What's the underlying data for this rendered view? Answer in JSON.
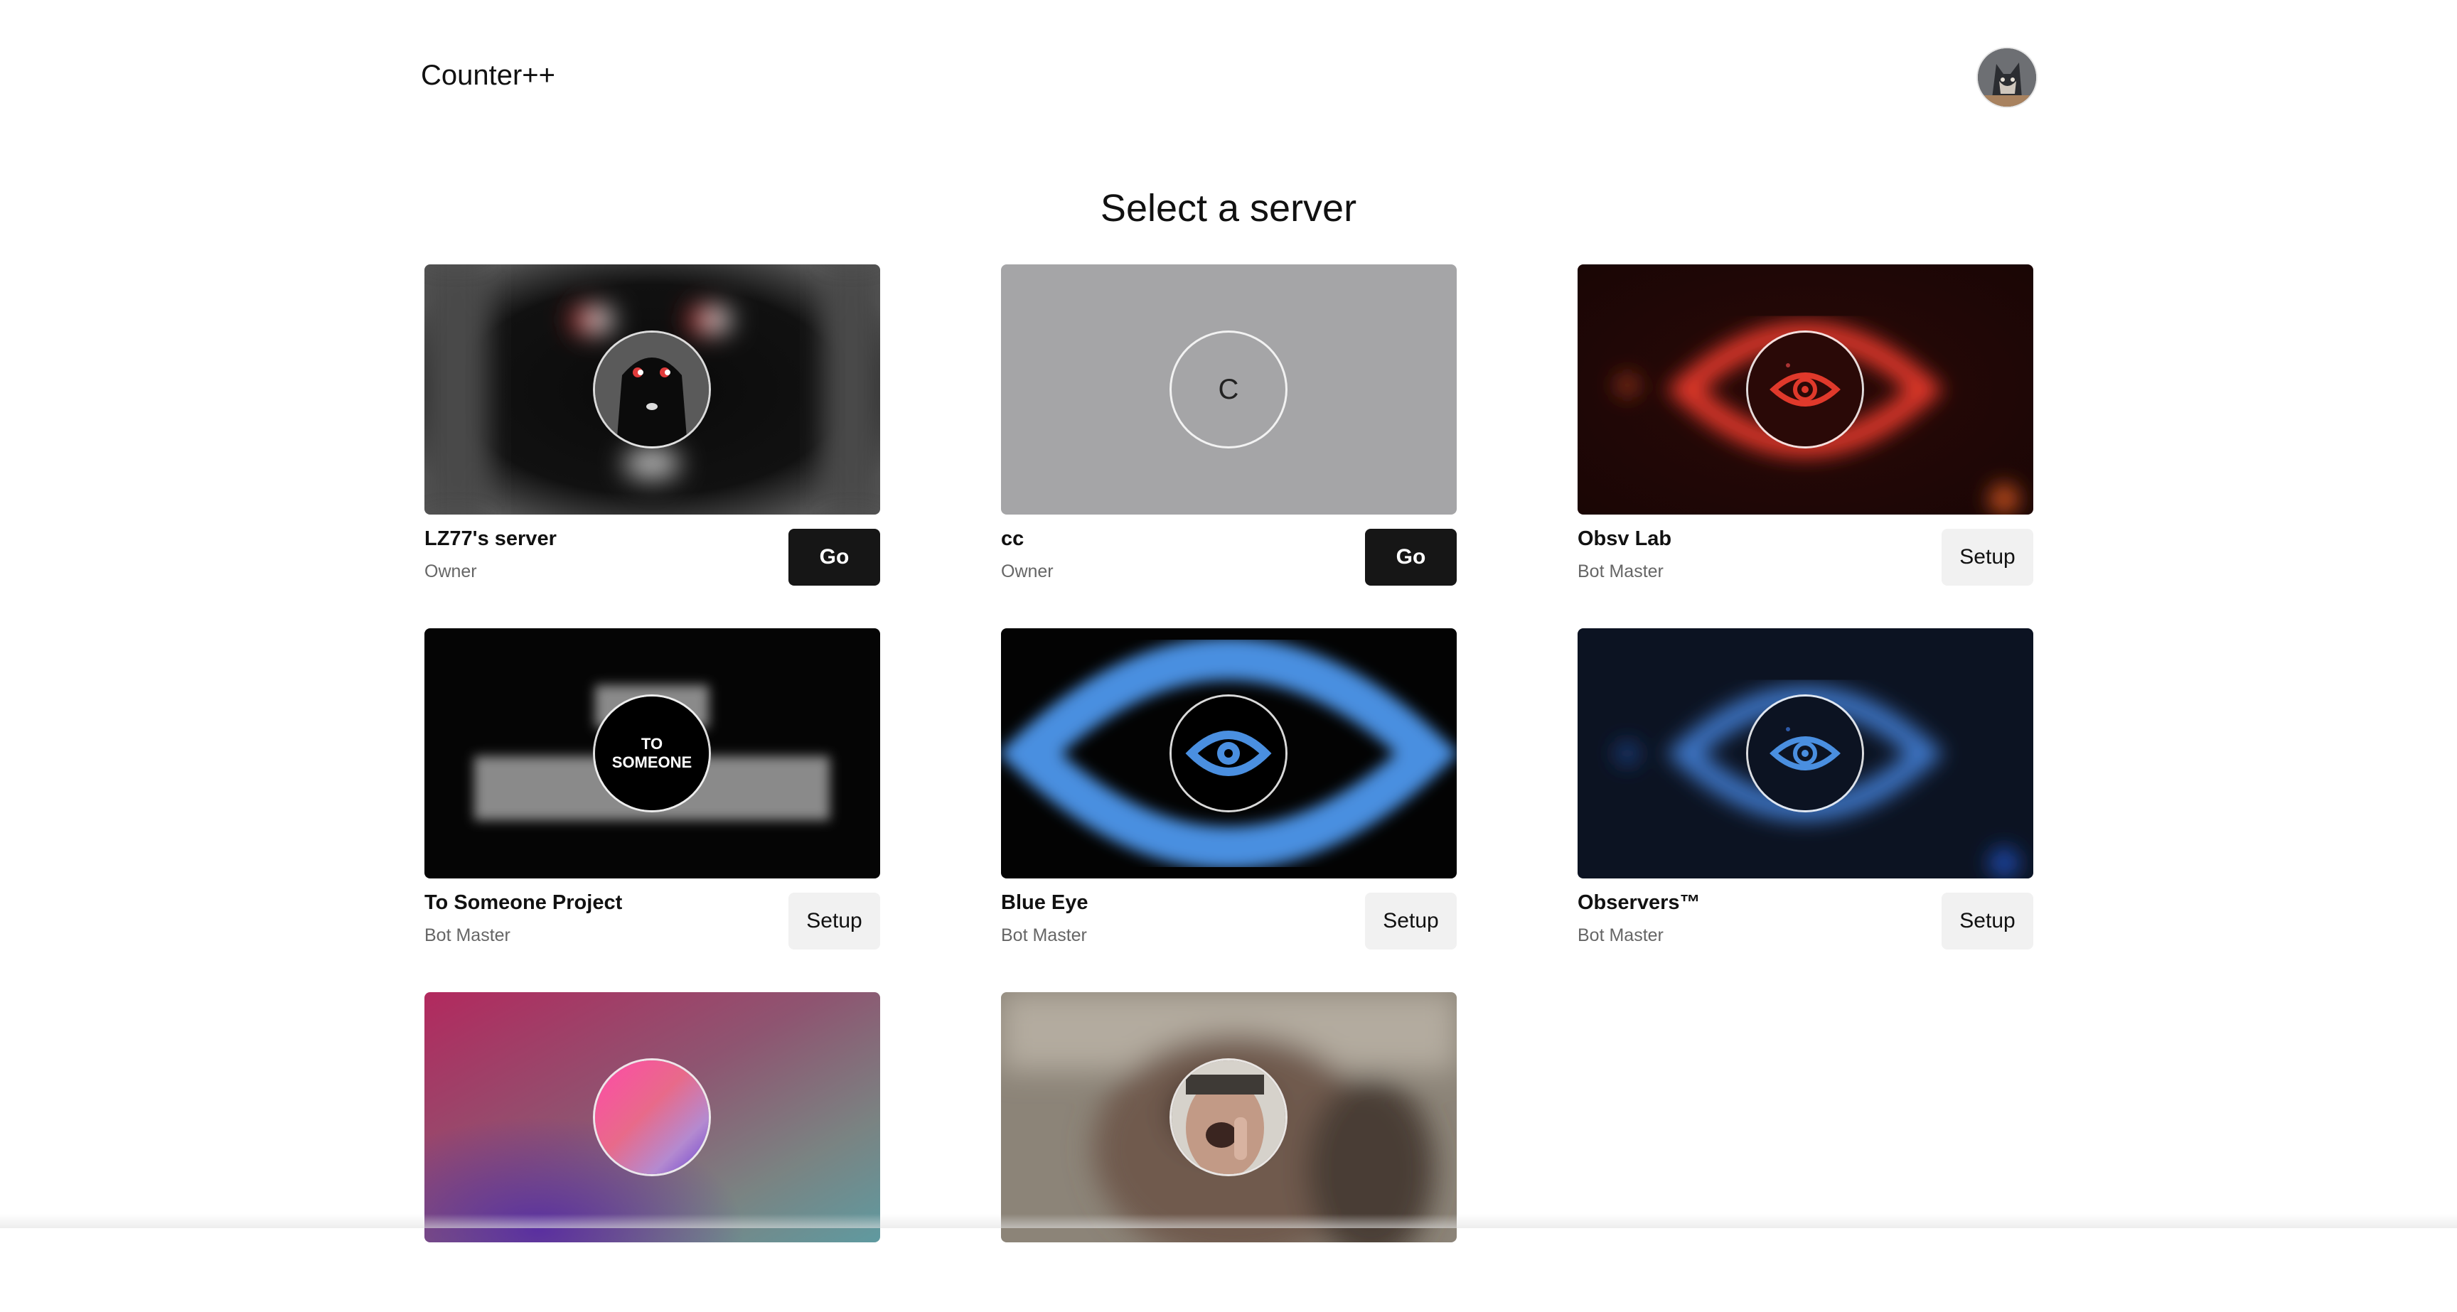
{
  "app": {
    "brand": "Counter++",
    "avatar_icon": "user-avatar"
  },
  "page": {
    "title": "Select a server"
  },
  "servers": [
    {
      "name": "LZ77's server",
      "role": "Owner",
      "action": "Go",
      "icon": "server-icon-lz77"
    },
    {
      "name": "cc",
      "role": "Owner",
      "action": "Go",
      "icon_initial": "C"
    },
    {
      "name": "Obsv Lab",
      "role": "Bot Master",
      "action": "Setup",
      "icon": "red-eye-icon"
    },
    {
      "name": "To Someone Project",
      "role": "Bot Master",
      "action": "Setup",
      "icon_text_line1": "TO",
      "icon_text_line2": "SOMEONE"
    },
    {
      "name": "Blue Eye",
      "role": "Bot Master",
      "action": "Setup",
      "icon": "blue-eye-icon"
    },
    {
      "name": "Observers™",
      "role": "Bot Master",
      "action": "Setup",
      "icon": "blue-eye-icon"
    },
    {
      "icon": "gradient-orb-icon"
    },
    {
      "icon": "photo-icon"
    }
  ],
  "colors": {
    "go_button": "#161616",
    "setup_button": "#f1f1f1",
    "role_text": "#666666",
    "red_eye": "#e0392b",
    "blue_eye": "#4a8fe0"
  }
}
